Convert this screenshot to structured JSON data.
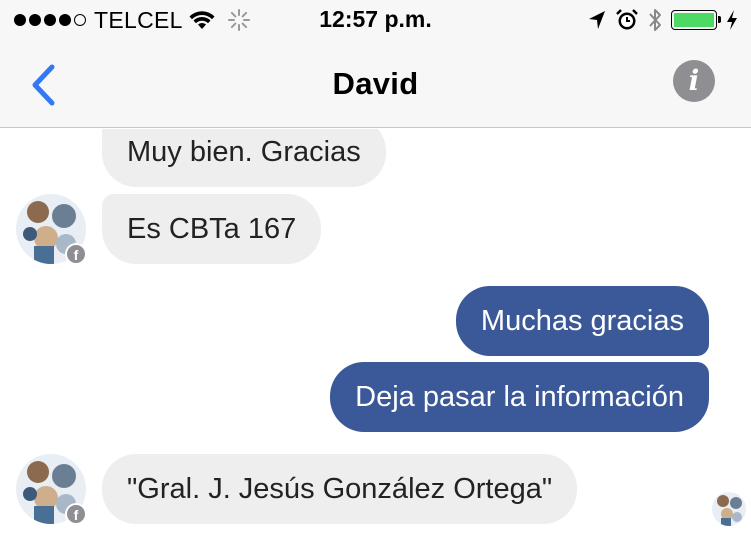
{
  "status_bar": {
    "carrier": "TELCEL",
    "time": "12:57 p.m.",
    "battery_color": "#4cd964"
  },
  "nav": {
    "back_icon": "chevron-left-icon",
    "title": "David",
    "info_icon": "info-icon"
  },
  "messages": [
    {
      "direction": "incoming",
      "text": "Muy bien. Gracias"
    },
    {
      "direction": "incoming",
      "text": "Es CBTa 167"
    },
    {
      "direction": "outgoing",
      "text": "Muchas gracias"
    },
    {
      "direction": "outgoing",
      "text": "Deja pasar la información"
    },
    {
      "direction": "incoming",
      "text": "\"Gral. J. Jesús González Ortega\""
    }
  ],
  "colors": {
    "outgoing_bubble": "#3b5998",
    "incoming_bubble": "#eeeeee",
    "accent": "#3478f6"
  }
}
